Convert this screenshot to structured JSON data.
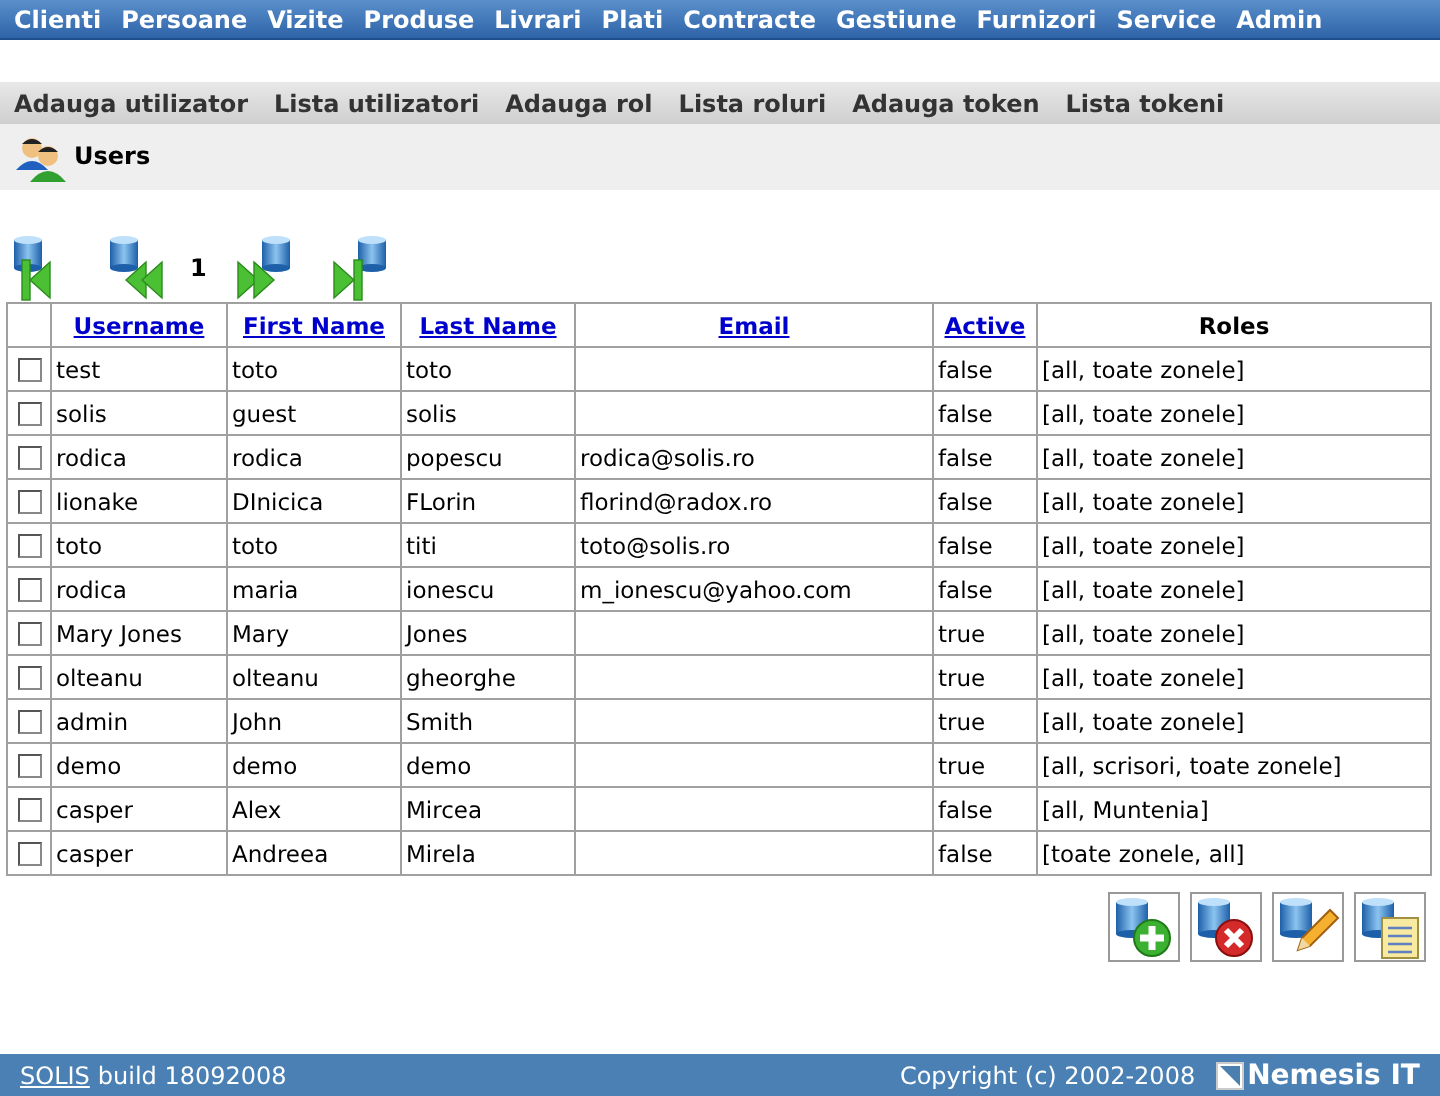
{
  "top_menu": [
    "Clienti",
    "Persoane",
    "Vizite",
    "Produse",
    "Livrari",
    "Plati",
    "Contracte",
    "Gestiune",
    "Furnizori",
    "Service",
    "Admin"
  ],
  "sub_menu": [
    "Adauga utilizator",
    "Lista utilizatori",
    "Adauga rol",
    "Lista roluri",
    "Adauga token",
    "Lista tokeni"
  ],
  "page_title": "Users",
  "pager": {
    "page": "1"
  },
  "table": {
    "columns": [
      {
        "label": "Username",
        "sortable": true
      },
      {
        "label": "First Name",
        "sortable": true
      },
      {
        "label": "Last Name",
        "sortable": true
      },
      {
        "label": "Email",
        "sortable": true
      },
      {
        "label": "Active",
        "sortable": true
      },
      {
        "label": "Roles",
        "sortable": false
      }
    ],
    "rows": [
      {
        "checked": false,
        "cells": [
          "test",
          "toto",
          "toto",
          "",
          "false",
          "[all, toate zonele]"
        ]
      },
      {
        "checked": false,
        "cells": [
          "solis",
          "guest",
          "solis",
          "",
          "false",
          "[all, toate zonele]"
        ]
      },
      {
        "checked": false,
        "cells": [
          "rodica",
          "rodica",
          "popescu",
          "rodica@solis.ro",
          "false",
          "[all, toate zonele]"
        ]
      },
      {
        "checked": false,
        "cells": [
          "lionake",
          "DInicica",
          "FLorin",
          "florind@radox.ro",
          "false",
          "[all, toate zonele]"
        ]
      },
      {
        "checked": false,
        "cells": [
          "toto",
          "toto",
          "titi",
          "toto@solis.ro",
          "false",
          "[all, toate zonele]"
        ]
      },
      {
        "checked": false,
        "cells": [
          "rodica",
          "maria",
          "ionescu",
          "m_ionescu@yahoo.com",
          "false",
          "[all, toate zonele]"
        ]
      },
      {
        "checked": false,
        "cells": [
          "Mary Jones",
          "Mary",
          "Jones",
          "",
          "true",
          "[all, toate zonele]"
        ]
      },
      {
        "checked": false,
        "cells": [
          "olteanu",
          "olteanu",
          "gheorghe",
          "",
          "true",
          "[all, toate zonele]"
        ]
      },
      {
        "checked": false,
        "cells": [
          "admin",
          "John",
          "Smith",
          "",
          "true",
          "[all, toate zonele]"
        ]
      },
      {
        "checked": false,
        "cells": [
          "demo",
          "demo",
          "demo",
          "",
          "true",
          "[all, scrisori, toate zonele]"
        ]
      },
      {
        "checked": false,
        "cells": [
          "casper",
          "Alex",
          "Mircea",
          "",
          "false",
          "[all, Muntenia]"
        ]
      },
      {
        "checked": false,
        "cells": [
          "casper",
          "Andreea",
          "Mirela",
          "",
          "false",
          "[toate zonele, all]"
        ]
      }
    ]
  },
  "actions": [
    {
      "kind": "add"
    },
    {
      "kind": "delete"
    },
    {
      "kind": "edit"
    },
    {
      "kind": "list"
    }
  ],
  "footer": {
    "link": "SOLIS",
    "build": "build 18092008",
    "copyright": "Copyright (c) 2002-2008",
    "brand": "Nemesis IT"
  }
}
